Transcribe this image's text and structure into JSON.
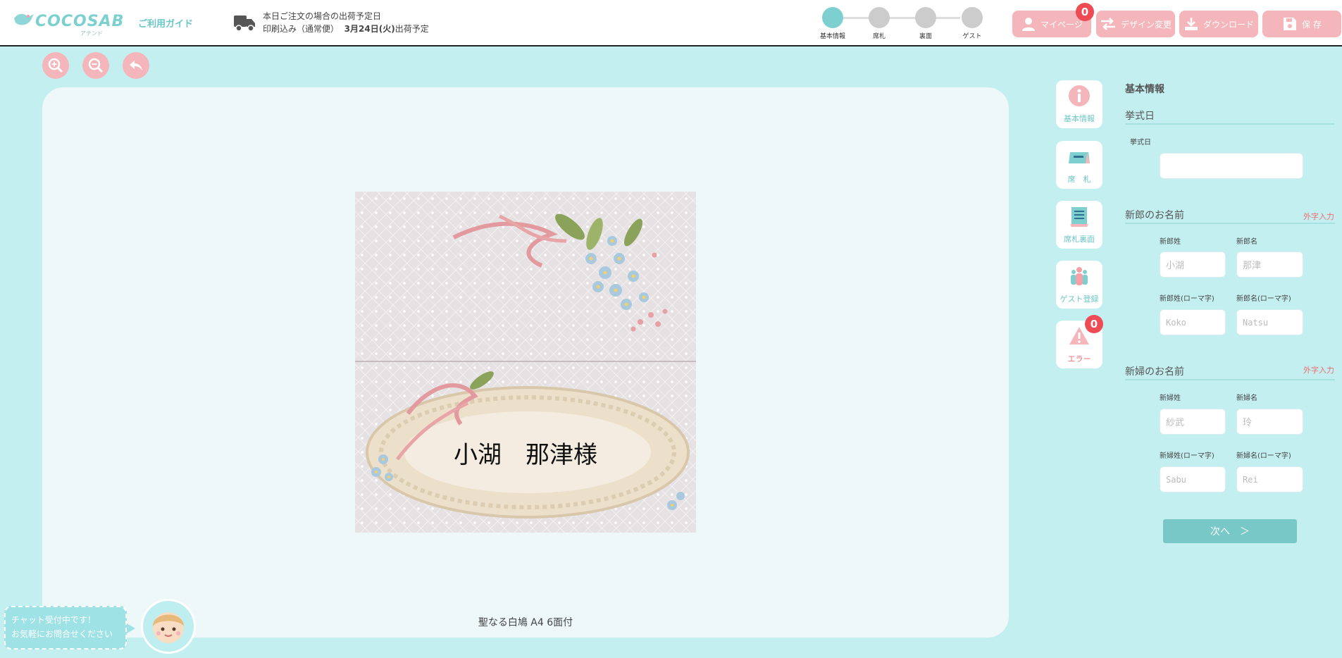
{
  "header": {
    "logo_text": "COCOSAB",
    "logo_sub": "アテンド",
    "guide_label": "ご利用ガイド",
    "ship_line1": "本日ご注文の場合の出荷予定日",
    "ship_prefix": "印刷込み（通常便）",
    "ship_date": "3月24日(火)",
    "ship_suffix": "出荷予定",
    "steps": [
      {
        "label": "基本情報",
        "active": true
      },
      {
        "label": "席札",
        "active": false
      },
      {
        "label": "裏面",
        "active": false
      },
      {
        "label": "ゲスト",
        "active": false
      }
    ],
    "mypage_label": "マイページ",
    "mypage_badge": "0",
    "design_label": "デザイン変更",
    "download_label": "ダウンロード",
    "save_label": "保 存"
  },
  "canvas": {
    "card_name": "小湖　那津様",
    "product_name": "聖なる白鳩 A4 6面付"
  },
  "side_nav": {
    "basic": "基本情報",
    "seat": "席　札",
    "back": "席札裏面",
    "guest": "ゲスト登録",
    "error": "エラー",
    "error_badge": "0"
  },
  "form": {
    "section_title": "基本情報",
    "ceremony_heading": "挙式日",
    "ceremony_label": "挙式日",
    "ceremony_value": "",
    "groom_heading": "新郎のお名前",
    "gaiji_link": "外字入力",
    "groom_last_label": "新郎姓",
    "groom_first_label": "新郎名",
    "groom_last_ph": "小湖",
    "groom_first_ph": "那津",
    "groom_last_roman_label": "新郎姓(ローマ字)",
    "groom_first_roman_label": "新郎名(ローマ字)",
    "groom_last_roman_ph": "Koko",
    "groom_first_roman_ph": "Natsu",
    "bride_heading": "新婦のお名前",
    "bride_last_label": "新婦姓",
    "bride_first_label": "新婦名",
    "bride_last_ph": "紗武",
    "bride_first_ph": "玲",
    "bride_last_roman_label": "新婦姓(ローマ字)",
    "bride_first_roman_label": "新婦名(ローマ字)",
    "bride_last_roman_ph": "Sabu",
    "bride_first_roman_ph": "Rei",
    "next_label": "次へ　＞"
  },
  "chat": {
    "line1": "チャット受付中です！",
    "line2": "お気軽にお問合せください"
  },
  "colors": {
    "accent_teal": "#7ecfcf",
    "pink": "#f4b6ba",
    "badge_red": "#ef4b55",
    "background": "#c4eff1"
  }
}
